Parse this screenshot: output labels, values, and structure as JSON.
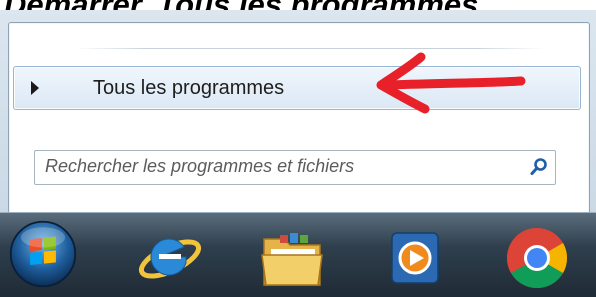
{
  "caption": {
    "text": "Démarrer, Tous les programmes"
  },
  "start_menu": {
    "all_programs_label": "Tous les programmes",
    "search": {
      "placeholder": "Rechercher les programmes et fichiers",
      "value": ""
    }
  },
  "annotation": {
    "color": "#e8202a"
  },
  "taskbar": {
    "icons": [
      {
        "name": "windows-start-orb"
      },
      {
        "name": "internet-explorer"
      },
      {
        "name": "file-explorer"
      },
      {
        "name": "windows-media-player"
      },
      {
        "name": "google-chrome"
      }
    ]
  },
  "colors": {
    "selection_border": "#98b6d4",
    "taskbar": "#2f3f4d"
  }
}
